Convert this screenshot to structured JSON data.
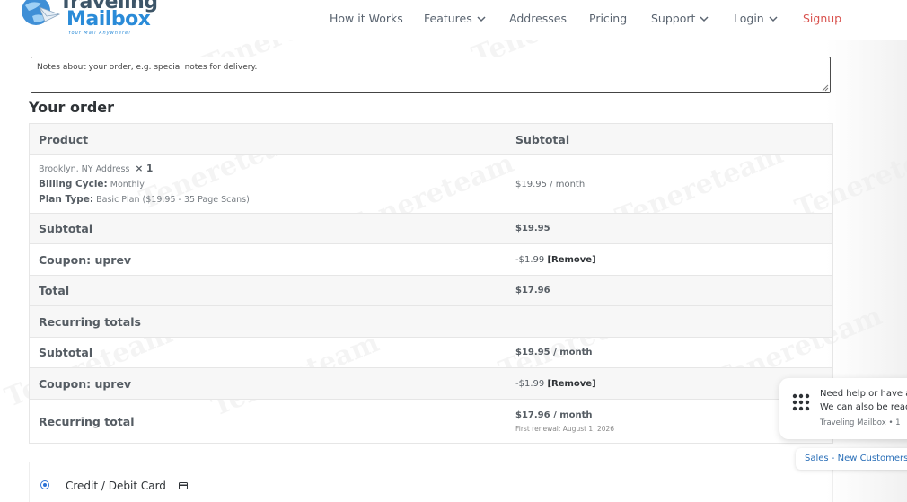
{
  "header": {
    "logo_line1": "Traveling",
    "logo_line2": "Mailbox",
    "logo_tagline": "Your Mail Anywhere!",
    "nav": [
      {
        "label": "How it Works",
        "dropdown": false
      },
      {
        "label": "Features",
        "dropdown": true
      },
      {
        "label": "Addresses",
        "dropdown": false
      },
      {
        "label": "Pricing",
        "dropdown": false
      },
      {
        "label": "Support",
        "dropdown": true
      },
      {
        "label": "Login",
        "dropdown": true
      },
      {
        "label": "Signup",
        "dropdown": false
      }
    ]
  },
  "notes": {
    "placeholder": "Notes about your order, e.g. special notes for delivery."
  },
  "order": {
    "title": "Your order",
    "col_product": "Product",
    "col_subtotal": "Subtotal",
    "product_name": "Brooklyn, NY Address",
    "product_qty": "× 1",
    "billing_cycle_label": "Billing Cycle:",
    "billing_cycle_value": "Monthly",
    "plan_type_label": "Plan Type:",
    "plan_type_value": "Basic Plan ($19.95 - 35 Page Scans)",
    "product_price": "$19.95 / month",
    "subtotal_label": "Subtotal",
    "subtotal_value": "$19.95",
    "coupon_label": "Coupon: uprev",
    "coupon_value": "-$1.99",
    "remove_label": "[Remove]",
    "total_label": "Total",
    "total_value": "$17.96",
    "recurring_header": "Recurring totals",
    "rec_subtotal_label": "Subtotal",
    "rec_subtotal_value": "$19.95 / month",
    "rec_coupon_label": "Coupon: uprev",
    "rec_coupon_value": "-$1.99",
    "rec_remove_label": "[Remove]",
    "rec_total_label": "Recurring total",
    "rec_total_value": "$17.96 / month",
    "first_renewal": "First renewal: August 1, 2026"
  },
  "payment": {
    "method_label": "Credit / Debit Card"
  },
  "chat": {
    "line1": "Need help or have a",
    "line2": "We can also be read",
    "line3": "Traveling Mailbox • 1",
    "button": "Sales - New Customers"
  },
  "watermark": "Tenereteam",
  "colors": {
    "signup": "#d9534f",
    "logo_blue": "#2a8bd8",
    "radio": "#2c72d6"
  }
}
